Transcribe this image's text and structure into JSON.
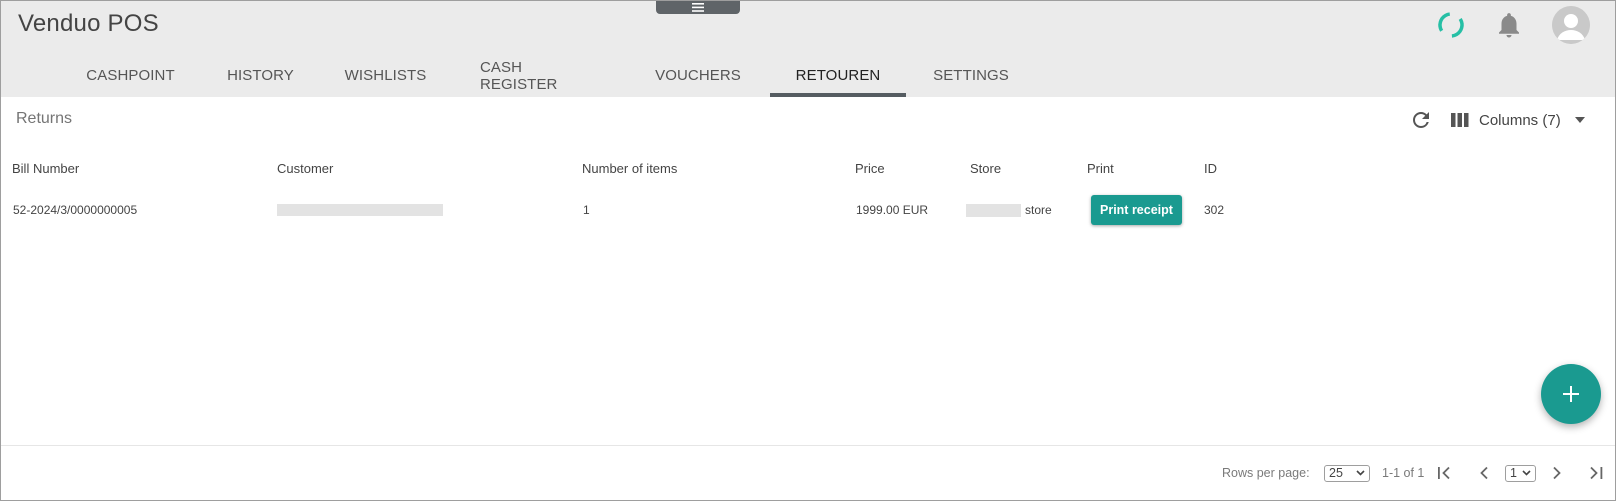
{
  "app": {
    "title": "Venduo POS"
  },
  "tabs": [
    {
      "label": "CASHPOINT",
      "active": false
    },
    {
      "label": "HISTORY",
      "active": false
    },
    {
      "label": "WISHLISTS",
      "active": false
    },
    {
      "label": "CASH REGISTER",
      "active": false
    },
    {
      "label": "VOUCHERS",
      "active": false
    },
    {
      "label": "RETOUREN",
      "active": true
    },
    {
      "label": "SETTINGS",
      "active": false
    }
  ],
  "toolbar": {
    "section_title": "Returns",
    "columns_label": "Columns (7)"
  },
  "table": {
    "headers": [
      "Bill Number",
      "Customer",
      "Number of items",
      "Price",
      "Store",
      "Print",
      "ID"
    ],
    "rows": [
      {
        "bill_number": "52-2024/3/0000000005",
        "customer": "",
        "items": "1",
        "price": "1999.00 EUR",
        "store_suffix": "store",
        "print_label": "Print receipt",
        "id": "302"
      }
    ]
  },
  "pagination": {
    "rows_per_page_label": "Rows per page:",
    "rows_per_page_value": "25",
    "range_text": "1-1 of 1",
    "page_value": "1"
  },
  "icons": {
    "header": [
      "menu-handle-icon",
      "loading-spinner-icon",
      "bell-icon",
      "avatar-icon"
    ],
    "toolbar": [
      "refresh-icon",
      "columns-icon",
      "caret-down-icon"
    ],
    "fab": "add-icon",
    "pagination": [
      "first-page-icon",
      "prev-page-icon",
      "next-page-icon",
      "last-page-icon"
    ]
  },
  "colors": {
    "header_bg": "#ebebeb",
    "accent": "#1a9a90",
    "spinner": "#26bfa5",
    "active_tab_indicator": "#555c61"
  }
}
